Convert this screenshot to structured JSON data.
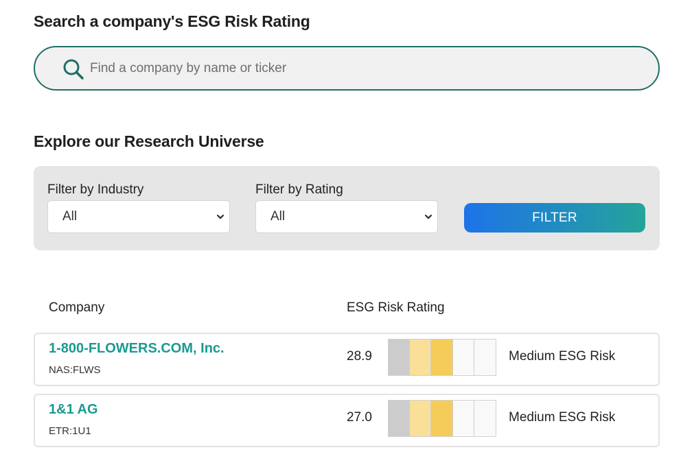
{
  "search": {
    "heading": "Search a company's ESG Risk Rating",
    "placeholder": "Find a company by name or ticker",
    "icon": "search-icon"
  },
  "explore": {
    "heading": "Explore our Research Universe",
    "filters": {
      "industry_label": "Filter by Industry",
      "industry_value": "All",
      "rating_label": "Filter by Rating",
      "rating_value": "All",
      "button_label": "FILTER"
    }
  },
  "table": {
    "columns": [
      "Company",
      "ESG Risk Rating"
    ],
    "scale_colors": [
      "#cccccc",
      "#f9df98",
      "#f5cc5a",
      "#f9f9f9",
      "#f9f9f9"
    ],
    "rows": [
      {
        "name": "1-800-FLOWERS.COM, Inc.",
        "ticker": "NAS:FLWS",
        "score": "28.9",
        "risk": "Medium ESG Risk"
      },
      {
        "name": "1&1 AG",
        "ticker": "ETR:1U1",
        "score": "27.0",
        "risk": "Medium ESG Risk"
      }
    ]
  }
}
